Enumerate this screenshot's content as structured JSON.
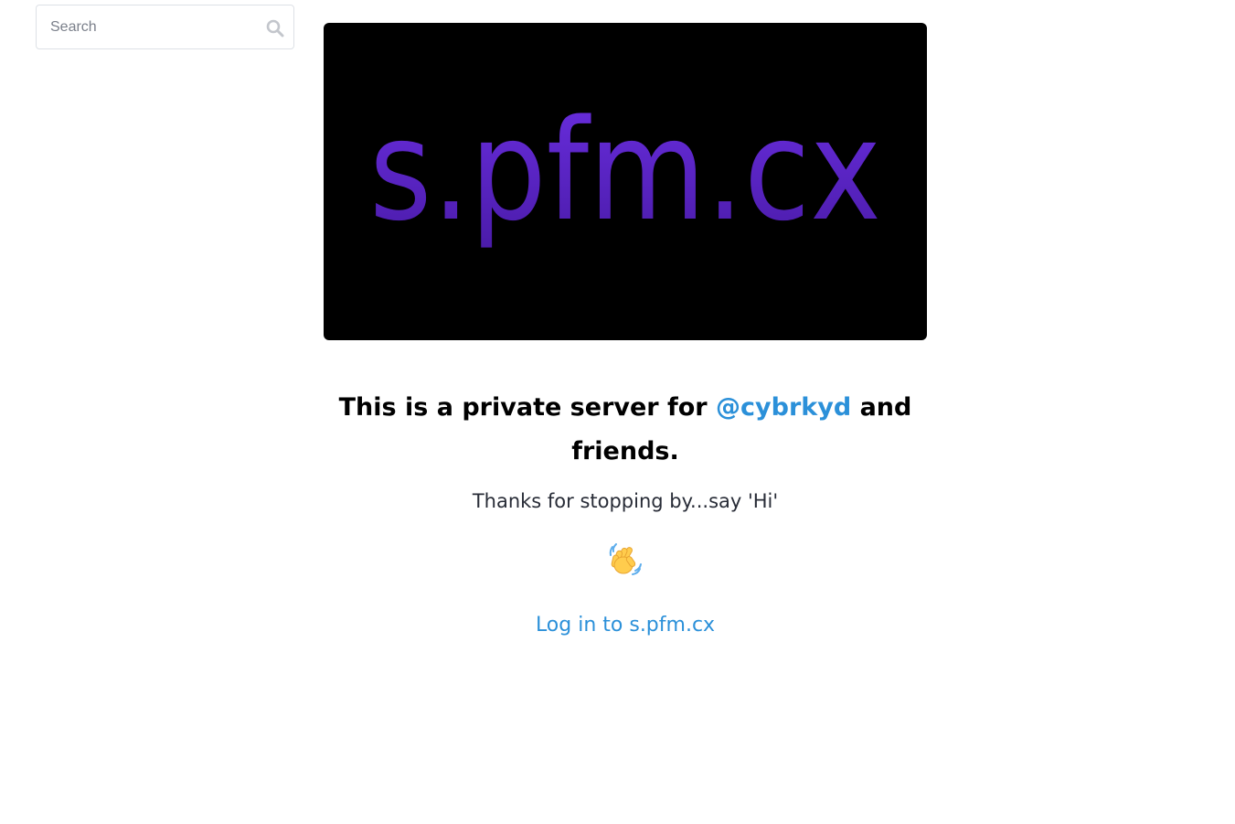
{
  "search": {
    "placeholder": "Search",
    "value": "",
    "icon": "search-icon"
  },
  "banner": {
    "logo_text": "s.pfm.cx",
    "logo_color": "#5b24c4",
    "background": "#000000"
  },
  "headline": {
    "prefix": "This is a private server for ",
    "mention": "@cybrkyd",
    "suffix": " and friends."
  },
  "tagline": "Thanks for stopping by...say 'Hi'",
  "emoji": {
    "icon": "waving-hand-icon",
    "char": "👋"
  },
  "login": {
    "label": "Log in to s.pfm.cx"
  },
  "colors": {
    "link": "#2b90d9",
    "text": "#282c37"
  }
}
